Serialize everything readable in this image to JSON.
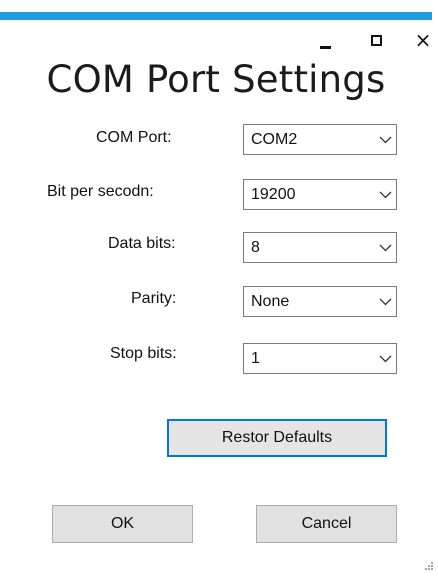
{
  "window": {
    "title": "COM Port Settings",
    "accent_color": "#1e9de0",
    "controls": {
      "minimize_icon": "minimize-icon",
      "maximize_icon": "maximize-icon",
      "close_icon": "close-icon",
      "close_glyph": "×"
    }
  },
  "form": {
    "fields": [
      {
        "label": "COM Port:",
        "value": "COM2"
      },
      {
        "label": "Bit per secodn:",
        "value": "19200"
      },
      {
        "label": "Data bits:",
        "value": "8"
      },
      {
        "label": "Parity:",
        "value": "None"
      },
      {
        "label": "Stop bits:",
        "value": "1"
      }
    ],
    "dropdown_icon": "chevron-down-icon"
  },
  "buttons": {
    "restore_defaults": "Restor Defaults",
    "ok": "OK",
    "cancel": "Cancel",
    "focus_color": "#0078d7"
  }
}
